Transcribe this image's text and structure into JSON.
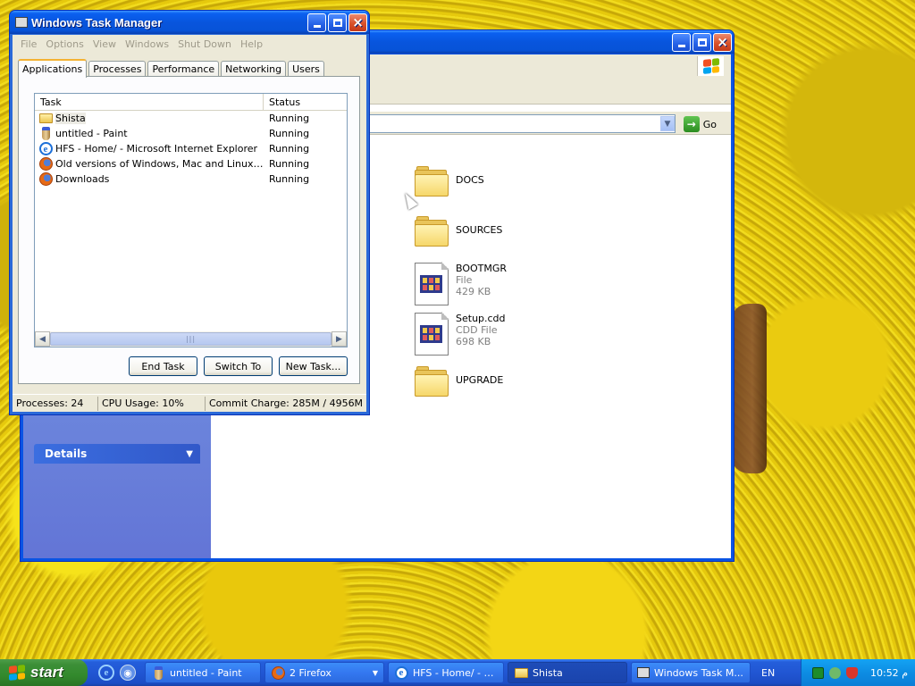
{
  "colors": {
    "xp_blue": "#0a54e3",
    "start_green": "#3c8f37",
    "window_face": "#ece9d8",
    "tab_highlight": "#f4b233"
  },
  "explorer": {
    "go_label": "Go",
    "details_label": "Details",
    "files": [
      {
        "name": "DOCS",
        "type": "",
        "size": "",
        "icon": "folder-icon"
      },
      {
        "name": "SOURCES",
        "type": "",
        "size": "",
        "icon": "folder-icon"
      },
      {
        "name": "BOOTMGR",
        "type": "File",
        "size": "429 KB",
        "icon": "file-icon"
      },
      {
        "name": "Setup.cdd",
        "type": "CDD File",
        "size": "698 KB",
        "icon": "file-icon"
      },
      {
        "name": "UPGRADE",
        "type": "",
        "size": "",
        "icon": "folder-icon"
      }
    ]
  },
  "taskmgr": {
    "title": "Windows Task Manager",
    "menu": [
      "File",
      "Options",
      "View",
      "Windows",
      "Shut Down",
      "Help"
    ],
    "tabs": [
      "Applications",
      "Processes",
      "Performance",
      "Networking",
      "Users"
    ],
    "active_tab": "Applications",
    "columns": {
      "task": "Task",
      "status": "Status"
    },
    "rows": [
      {
        "task": "Shista",
        "status": "Running",
        "icon": "folder-icon"
      },
      {
        "task": "untitled - Paint",
        "status": "Running",
        "icon": "paint-icon"
      },
      {
        "task": "HFS - Home/ - Microsoft Internet Explorer",
        "status": "Running",
        "icon": "ie-icon"
      },
      {
        "task": "Old versions of Windows, Mac and Linux Soft...",
        "status": "Running",
        "icon": "firefox-icon"
      },
      {
        "task": "Downloads",
        "status": "Running",
        "icon": "firefox-icon"
      }
    ],
    "buttons": {
      "end_task": "End Task",
      "switch_to": "Switch To",
      "new_task": "New Task..."
    },
    "status": {
      "processes": "Processes: 24",
      "cpu": "CPU Usage: 10%",
      "commit": "Commit Charge: 285M / 4956M"
    }
  },
  "taskbar": {
    "start_label": "start",
    "items": [
      {
        "label": "untitled - Paint",
        "icon": "paint-icon",
        "group": false,
        "active": false
      },
      {
        "label": "2 Firefox",
        "icon": "firefox-icon",
        "group": true,
        "active": false
      },
      {
        "label": "HFS - Home/ - Mi...",
        "icon": "ie-icon",
        "group": false,
        "active": false
      },
      {
        "label": "Shista",
        "icon": "folder-icon",
        "group": false,
        "active": true
      },
      {
        "label": "Windows Task M...",
        "icon": "taskmgr-icon",
        "group": false,
        "active": false
      }
    ],
    "language": "EN",
    "clock": "10:52 م"
  }
}
